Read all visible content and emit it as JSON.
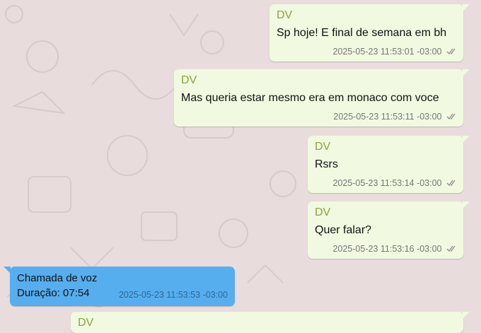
{
  "messages": [
    {
      "sender": "DV",
      "text": "Sp hoje! E final de semana em bh",
      "timestamp": "2025-05-23 11:53:01 -03:00",
      "status": "read"
    },
    {
      "sender": "DV",
      "text": "Mas queria estar mesmo era em monaco com voce",
      "timestamp": "2025-05-23 11:53:11 -03:00",
      "status": "read"
    },
    {
      "sender": "DV",
      "text": "Rsrs",
      "timestamp": "2025-05-23 11:53:14 -03:00",
      "status": "read"
    },
    {
      "sender": "DV",
      "text": "Quer falar?",
      "timestamp": "2025-05-23 11:53:16 -03:00",
      "status": "read"
    }
  ],
  "call": {
    "title": "Chamada de voz",
    "duration": "Duração: 07:54",
    "timestamp": "2025-05-23 11:53:53 -03:00"
  },
  "partial_message": {
    "sender": "DV"
  },
  "colors": {
    "outgoing_bubble": "#f1fae0",
    "call_bubble": "#56aeee",
    "sender_name": "#8aa43a",
    "background": "#e9dcdc"
  },
  "icons": {
    "read_receipt": "double-check-icon"
  }
}
